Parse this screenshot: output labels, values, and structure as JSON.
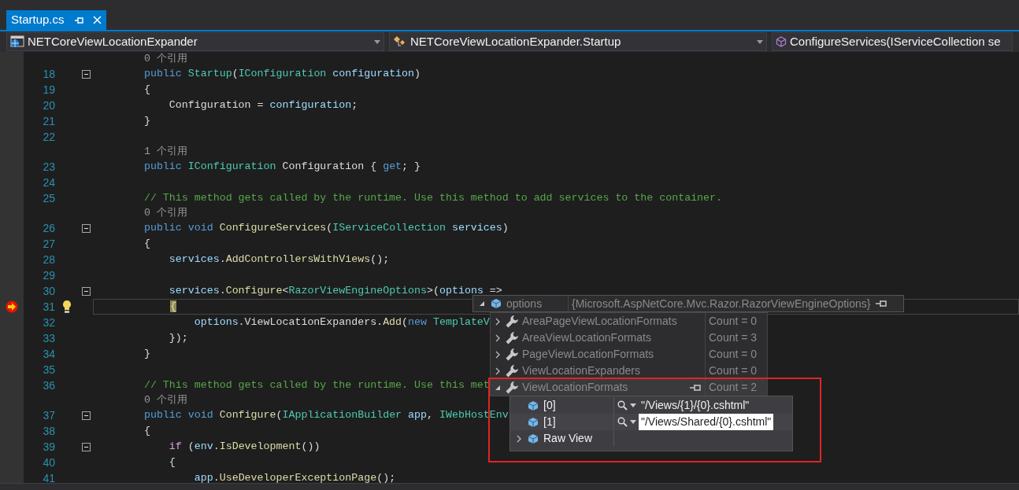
{
  "tab": {
    "title": "Startup.cs",
    "selected": true
  },
  "nav": [
    {
      "kind": "project",
      "text": "NETCoreViewLocationExpander"
    },
    {
      "kind": "class",
      "text": "NETCoreViewLocationExpander.Startup"
    },
    {
      "kind": "method",
      "text": "ConfigureServices(IServiceCollection se"
    }
  ],
  "lines": [
    {
      "kind": "lens",
      "text": "    0 个引用"
    },
    {
      "kind": "code",
      "number": "18",
      "fold": true,
      "tokens": [
        {
          "kind": "kw",
          "t": "    public "
        },
        {
          "kind": "type",
          "t": "Startup"
        },
        {
          "kind": "plain",
          "t": "("
        },
        {
          "kind": "type",
          "t": "IConfiguration "
        },
        {
          "kind": "param",
          "t": "configuration"
        },
        {
          "kind": "plain",
          "t": ")"
        }
      ]
    },
    {
      "kind": "code",
      "number": "19",
      "fold": false,
      "tokens": [
        {
          "kind": "plain",
          "t": "    {"
        }
      ]
    },
    {
      "kind": "code",
      "number": "20",
      "fold": false,
      "tokens": [
        {
          "kind": "plain",
          "t": "        Configuration = "
        },
        {
          "kind": "param",
          "t": "configuration"
        },
        {
          "kind": "plain",
          "t": ";"
        }
      ]
    },
    {
      "kind": "code",
      "number": "21",
      "fold": false,
      "tokens": [
        {
          "kind": "plain",
          "t": "    }"
        }
      ]
    },
    {
      "kind": "code",
      "number": "22",
      "fold": false
    },
    {
      "kind": "lens",
      "text": "    1 个引用"
    },
    {
      "kind": "code",
      "number": "23",
      "fold": false,
      "tokens": [
        {
          "kind": "kw",
          "t": "    public "
        },
        {
          "kind": "type",
          "t": "IConfiguration "
        },
        {
          "kind": "plain",
          "t": "Configuration { "
        },
        {
          "kind": "kw",
          "t": "get"
        },
        {
          "kind": "plain",
          "t": "; }"
        }
      ]
    },
    {
      "kind": "code",
      "number": "24",
      "fold": false
    },
    {
      "kind": "code",
      "number": "25",
      "fold": false,
      "tokens": [
        {
          "kind": "comment",
          "t": "    // This method gets called by the runtime. Use this method to add services to the container."
        }
      ]
    },
    {
      "kind": "lens",
      "text": "    0 个引用"
    },
    {
      "kind": "code",
      "number": "26",
      "fold": true,
      "tokens": [
        {
          "kind": "kw",
          "t": "    public void "
        },
        {
          "kind": "method",
          "t": "ConfigureServices"
        },
        {
          "kind": "plain",
          "t": "("
        },
        {
          "kind": "type",
          "t": "IServiceCollection "
        },
        {
          "kind": "param",
          "t": "services"
        },
        {
          "kind": "plain",
          "t": ")"
        }
      ]
    },
    {
      "kind": "code",
      "number": "27",
      "fold": false,
      "tokens": [
        {
          "kind": "plain",
          "t": "    {"
        }
      ]
    },
    {
      "kind": "code",
      "number": "28",
      "fold": false,
      "tokens": [
        {
          "kind": "param",
          "t": "        services"
        },
        {
          "kind": "plain",
          "t": "."
        },
        {
          "kind": "method",
          "t": "AddControllersWithViews"
        },
        {
          "kind": "plain",
          "t": "();"
        }
      ]
    },
    {
      "kind": "code",
      "number": "29",
      "fold": false
    },
    {
      "kind": "code",
      "number": "30",
      "fold": true,
      "tokens": [
        {
          "kind": "param",
          "t": "        services"
        },
        {
          "kind": "plain",
          "t": "."
        },
        {
          "kind": "method",
          "t": "Configure"
        },
        {
          "kind": "plain",
          "t": "<"
        },
        {
          "kind": "type",
          "t": "RazorViewEngineOptions"
        },
        {
          "kind": "plain",
          "t": ">("
        },
        {
          "kind": "param",
          "t": "options"
        },
        {
          "kind": "plain",
          "t": " =>"
        }
      ]
    },
    {
      "kind": "code",
      "number": "31",
      "fold": false,
      "current": true,
      "bulb": true,
      "tokens": [
        {
          "kind": "match",
          "t": "{"
        }
      ]
    },
    {
      "kind": "code",
      "number": "32",
      "fold": false,
      "tokens": [
        {
          "kind": "param",
          "t": "            options"
        },
        {
          "kind": "plain",
          "t": ".ViewLocationExpanders."
        },
        {
          "kind": "method",
          "t": "Add"
        },
        {
          "kind": "plain",
          "t": "("
        },
        {
          "kind": "kw",
          "t": "new "
        },
        {
          "kind": "type",
          "t": "TemplateV"
        }
      ]
    },
    {
      "kind": "code",
      "number": "33",
      "fold": false,
      "tokens": [
        {
          "kind": "plain",
          "t": "        });"
        }
      ]
    },
    {
      "kind": "code",
      "number": "34",
      "fold": false,
      "tokens": [
        {
          "kind": "plain",
          "t": "    }"
        }
      ]
    },
    {
      "kind": "code",
      "number": "35",
      "fold": false
    },
    {
      "kind": "code",
      "number": "36",
      "fold": false,
      "tokens": [
        {
          "kind": "comment",
          "t": "    // This method gets called by the runtime. Use this met"
        }
      ]
    },
    {
      "kind": "lens",
      "text": "    0 个引用"
    },
    {
      "kind": "code",
      "number": "37",
      "fold": true,
      "tokens": [
        {
          "kind": "kw",
          "t": "    public void "
        },
        {
          "kind": "method",
          "t": "Configure"
        },
        {
          "kind": "plain",
          "t": "("
        },
        {
          "kind": "type",
          "t": "IApplicationBuilder "
        },
        {
          "kind": "param",
          "t": "app"
        },
        {
          "kind": "plain",
          "t": ", "
        },
        {
          "kind": "type",
          "t": "IWebHostEnv"
        }
      ]
    },
    {
      "kind": "code",
      "number": "38",
      "fold": false,
      "tokens": [
        {
          "kind": "plain",
          "t": "    {"
        }
      ]
    },
    {
      "kind": "code",
      "number": "39",
      "fold": true,
      "tokens": [
        {
          "kind": "ctl",
          "t": "        if "
        },
        {
          "kind": "plain",
          "t": "("
        },
        {
          "kind": "param",
          "t": "env"
        },
        {
          "kind": "plain",
          "t": "."
        },
        {
          "kind": "method",
          "t": "IsDevelopment"
        },
        {
          "kind": "plain",
          "t": "())"
        }
      ]
    },
    {
      "kind": "code",
      "number": "40",
      "fold": false,
      "tokens": [
        {
          "kind": "plain",
          "t": "        {"
        }
      ]
    },
    {
      "kind": "code",
      "number": "41",
      "fold": false,
      "tokens": [
        {
          "kind": "param",
          "t": "            app"
        },
        {
          "kind": "plain",
          "t": "."
        },
        {
          "kind": "method",
          "t": "UseDeveloperExceptionPage"
        },
        {
          "kind": "plain",
          "t": "();"
        }
      ]
    }
  ],
  "datatip": {
    "name": "options",
    "value": "{Microsoft.AspNetCore.Mvc.Razor.RazorViewEngineOptions}",
    "expanded": true,
    "members": [
      {
        "name": "AreaPageViewLocationFormats",
        "value": "Count = 0",
        "expanded": false,
        "selected": false
      },
      {
        "name": "AreaViewLocationFormats",
        "value": "Count = 3",
        "expanded": false,
        "selected": false
      },
      {
        "name": "PageViewLocationFormats",
        "value": "Count = 0",
        "expanded": false,
        "selected": false
      },
      {
        "name": "ViewLocationExpanders",
        "value": "Count = 0",
        "expanded": false,
        "selected": false
      },
      {
        "name": "ViewLocationFormats",
        "value": "Count = 2",
        "expanded": true,
        "selected": true,
        "children": [
          {
            "name": "[0]",
            "value": "\"/Views/{1}/{0}.cshtml\"",
            "expandable": false,
            "selected": false
          },
          {
            "name": "[1]",
            "value": "\"/Views/Shared/{0}.cshtml\"",
            "expandable": false,
            "selected": true
          },
          {
            "name": "Raw View",
            "expandable": true,
            "selected": false
          }
        ]
      }
    ]
  }
}
